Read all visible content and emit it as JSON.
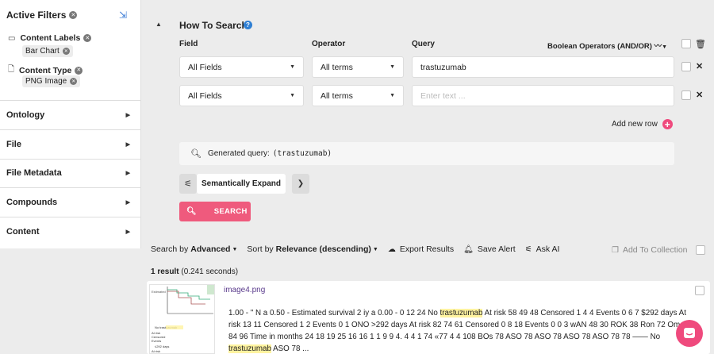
{
  "sidebar": {
    "title": "Active Filters",
    "filters": [
      {
        "label": "Content Labels",
        "chips": [
          "Bar Chart"
        ]
      },
      {
        "label": "Content Type",
        "chips": [
          "PNG Image"
        ]
      }
    ],
    "sections": [
      "Ontology",
      "File",
      "File Metadata",
      "Compounds",
      "Content"
    ]
  },
  "search": {
    "title": "How To Search",
    "columns": {
      "field": "Field",
      "operator": "Operator",
      "query": "Query",
      "boolean": "Boolean Operators (AND/OR)"
    },
    "rows": [
      {
        "field": "All Fields",
        "operator": "All terms",
        "query": "trastuzumab"
      },
      {
        "field": "All Fields",
        "operator": "All terms",
        "query": ""
      }
    ],
    "placeholder": "Enter text ...",
    "add_row": "Add new row",
    "generated_label": "Generated query:",
    "generated_query": "(trastuzumab)",
    "semantic_expand": "Semantically Expand",
    "search_button": "SEARCH"
  },
  "toolbar": {
    "search_by_prefix": "Search by",
    "search_by_value": "Advanced",
    "sort_by_prefix": "Sort by",
    "sort_by_value": "Relevance (descending)",
    "export": "Export Results",
    "save_alert": "Save Alert",
    "ask_ai": "Ask AI",
    "add_to_collection": "Add To Collection"
  },
  "results": {
    "count": "1 result",
    "time": "(0.241 seconds)",
    "items": [
      {
        "title": "image4.png",
        "snippet_parts": [
          "1.00 - \" N a 0.50 - Estimated survival 2 iy a 0.00 - 0 12 24 No ",
          "trastuzumab",
          " At risk 58 49 48 Censored 1 4 4 Events 0 6 7 $292 days At risk 13 11 Censored 1 2 Events 0 1 ONO >292 days At risk 82 74 61 Censored 0 8 18 Events 0 0 3 wAN 48 30 ROK 38 Ron 72 Om 84 96 Time in months 24 18 19 25 16 16 1 1 9 9 4. 4 4 1 74 «77 4 4 108 BOs 78 ASO 78 ASO 78 ASO 78 ASO 78 78 —— No ",
          "trastuzumab",
          " ASO 78 ..."
        ]
      }
    ]
  },
  "thumb_text": [
    "No trastuzumab",
    "At risk",
    "Censored",
    "Events",
    "≤292 days",
    "At risk",
    "Censored",
    "Estimated"
  ],
  "colors": {
    "accent": "#ef4a7d",
    "search_button": "#ef5a7d",
    "help": "#2f7fd3",
    "link": "#5a3a8c",
    "highlight": "#fff3a0"
  }
}
